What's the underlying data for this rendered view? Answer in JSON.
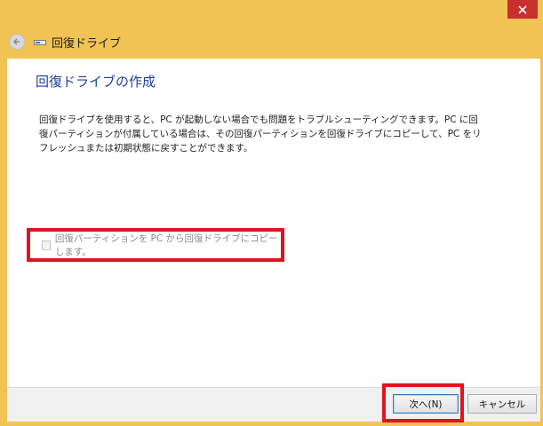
{
  "window": {
    "title": "回復ドライブ",
    "accent_color": "#f0c354",
    "close_color": "#c7302c"
  },
  "nav": {
    "back_icon": "back-arrow-icon",
    "drive_icon": "drive-icon"
  },
  "main": {
    "heading": "回復ドライブの作成",
    "description": "回復ドライブを使用すると、PC が起動しない場合でも問題をトラブルシューティングできます。PC に回復パーティションが付属している場合は、その回復パーティションを回復ドライブにコピーして、PC をリフレッシュまたは初期状態に戻すことができます。",
    "checkbox_label": "回復パーティションを PC から回復ドライブにコピーします。",
    "checkbox_checked": false,
    "checkbox_enabled": false
  },
  "footer": {
    "next_label": "次へ(N)",
    "cancel_label": "キャンセル"
  },
  "highlight_color": "#e0141e"
}
